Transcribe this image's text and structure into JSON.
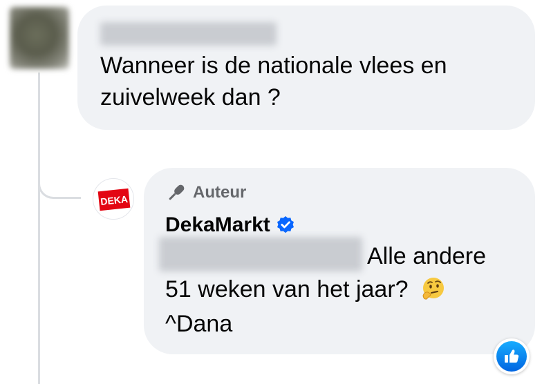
{
  "top_comment": {
    "text": "Wanneer is de nationale vlees en zuivelweek dan ?"
  },
  "reply": {
    "author_badge": "Auteur",
    "page_name": "DekaMarkt",
    "text_line_1": "Alle andere",
    "text_line_2": "51 weken van het jaar?",
    "text_line_3": "^Dana",
    "emoji": "thinking-face",
    "logo_text": "DEKA",
    "verified": true
  },
  "reaction": {
    "type": "like"
  },
  "colors": {
    "bubble": "#f0f2f5",
    "verified": "#0866ff",
    "like_gradient_top": "#18acfe",
    "like_gradient_bottom": "#0165e1",
    "deka_red": "#e30613",
    "secondary_text": "#65676b"
  }
}
